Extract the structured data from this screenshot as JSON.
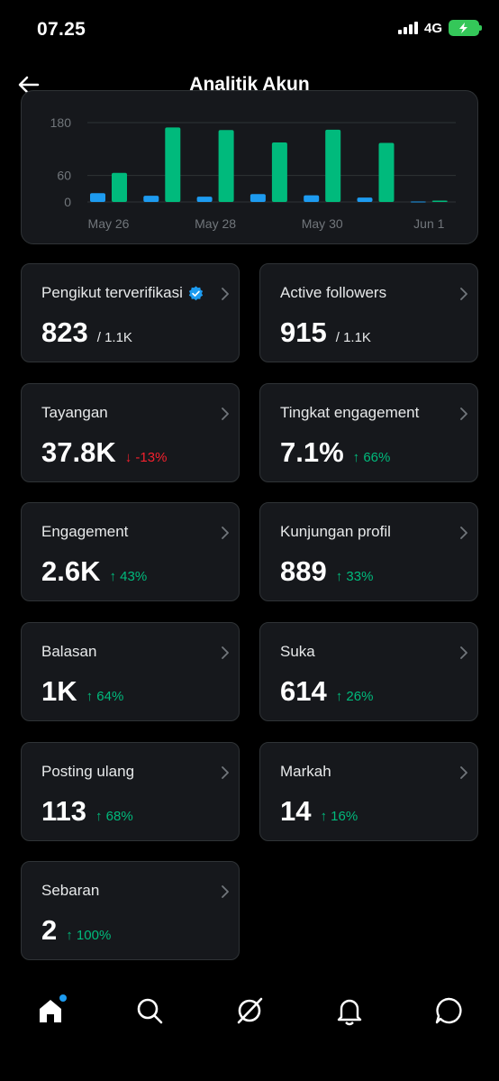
{
  "status": {
    "time": "07.25",
    "network": "4G"
  },
  "header": {
    "title": "Analitik Akun"
  },
  "chart_data": {
    "type": "bar",
    "categories": [
      "May 26",
      "May 27",
      "May 28",
      "May 29",
      "May 30",
      "May 31",
      "Jun 1"
    ],
    "x_tick_labels": [
      "May 26",
      "May 28",
      "May 30",
      "Jun 1"
    ],
    "y_tick_labels": [
      "180",
      "60",
      "0"
    ],
    "ylim": [
      0,
      180
    ],
    "series": [
      {
        "color": "#1d9bf0",
        "values": [
          20,
          14,
          12,
          18,
          15,
          10,
          1
        ]
      },
      {
        "color": "#00ba7c",
        "values": [
          66,
          169,
          163,
          135,
          164,
          134,
          3
        ]
      }
    ]
  },
  "cards": [
    {
      "label": "Pengikut terverifikasi",
      "value": "823",
      "sub": "/ 1.1K",
      "change": "",
      "verified": true
    },
    {
      "label": "Active followers",
      "value": "915",
      "sub": "/ 1.1K",
      "change": ""
    },
    {
      "label": "Tayangan",
      "value": "37.8K",
      "sub": "",
      "change": "↓ -13%",
      "direction": "down"
    },
    {
      "label": "Tingkat engagement",
      "value": "7.1%",
      "sub": "",
      "change": "↑ 66%",
      "direction": "up"
    },
    {
      "label": "Engagement",
      "value": "2.6K",
      "sub": "",
      "change": "↑ 43%",
      "direction": "up"
    },
    {
      "label": "Kunjungan profil",
      "value": "889",
      "sub": "",
      "change": "↑ 33%",
      "direction": "up"
    },
    {
      "label": "Balasan",
      "value": "1K",
      "sub": "",
      "change": "↑ 64%",
      "direction": "up"
    },
    {
      "label": "Suka",
      "value": "614",
      "sub": "",
      "change": "↑ 26%",
      "direction": "up"
    },
    {
      "label": "Posting ulang",
      "value": "113",
      "sub": "",
      "change": "↑ 68%",
      "direction": "up"
    },
    {
      "label": "Markah",
      "value": "14",
      "sub": "",
      "change": "↑ 16%",
      "direction": "up"
    },
    {
      "label": "Sebaran",
      "value": "2",
      "sub": "",
      "change": "↑ 100%",
      "direction": "up"
    }
  ],
  "nav": {
    "items": [
      "home-icon",
      "search-icon",
      "grok-icon",
      "notifications-icon",
      "messages-icon"
    ],
    "active": "home-icon"
  }
}
